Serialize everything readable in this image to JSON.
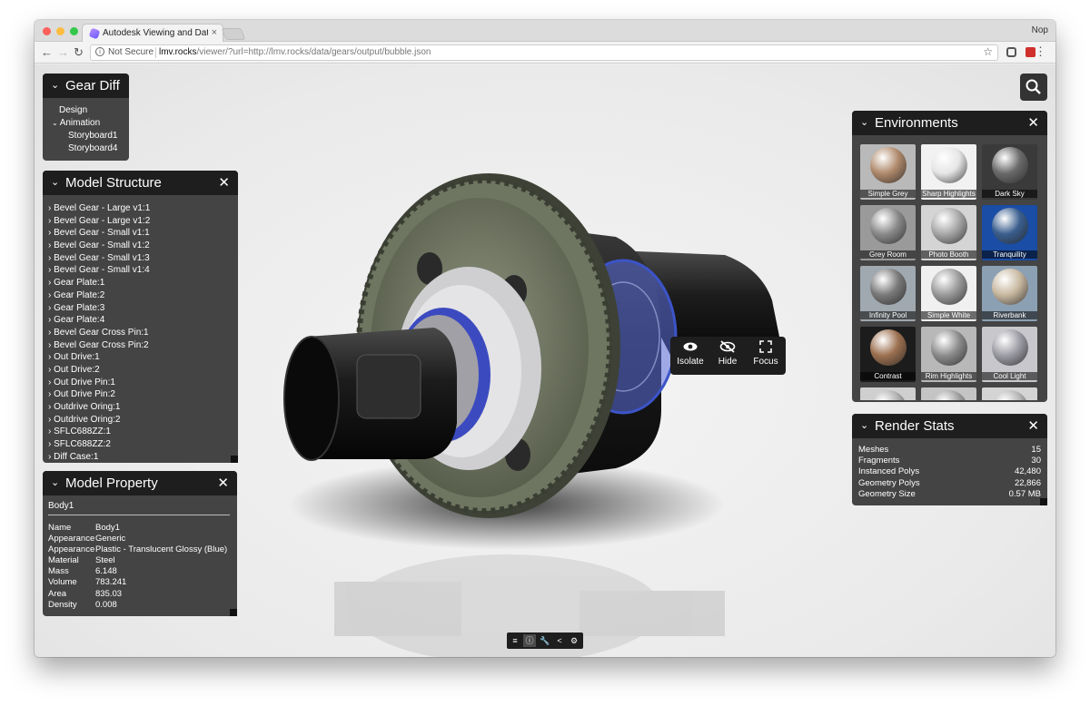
{
  "browser": {
    "tab_title": "Autodesk Viewing and Data API",
    "tab_close": "×",
    "profile": "Nop",
    "security_label": "Not Secure",
    "url_host": "lmv.rocks",
    "url_path": "/viewer/?url=http://lmv.rocks/data/gears/output/bubble.json",
    "nav_back": "←",
    "nav_forward": "→",
    "nav_reload": "↻",
    "bookmark": "☆",
    "menu": "⋮"
  },
  "gear_diff": {
    "title": "Gear Diff",
    "chevron": "⌄",
    "items": [
      "Design",
      "Animation",
      "Storyboard1",
      "Storyboard4"
    ],
    "expand_glyph": "⌄"
  },
  "model_structure": {
    "title": "Model Structure",
    "close": "✕",
    "items": [
      "Bevel Gear - Large v1:1",
      "Bevel Gear - Large v1:2",
      "Bevel Gear - Small v1:1",
      "Bevel Gear - Small v1:2",
      "Bevel Gear - Small v1:3",
      "Bevel Gear - Small v1:4",
      "Gear Plate:1",
      "Gear Plate:2",
      "Gear Plate:3",
      "Gear Plate:4",
      "Bevel Gear Cross Pin:1",
      "Bevel Gear Cross Pin:2",
      "Out Drive:1",
      "Out Drive:2",
      "Out Drive Pin:1",
      "Out Drive Pin:2",
      "Outdrive Oring:1",
      "Outdrive Oring:2",
      "SFLC688ZZ:1",
      "SFLC688ZZ:2",
      "Diff Case:1"
    ]
  },
  "model_property": {
    "title": "Model Property",
    "close": "✕",
    "node_name": "Body1",
    "rows": [
      {
        "key": "Name",
        "value": "Body1"
      },
      {
        "key": "Appearance",
        "value": "Generic"
      },
      {
        "key": "Appearance",
        "value": "Plastic - Translucent Glossy (Blue)"
      },
      {
        "key": "Material",
        "value": "Steel"
      },
      {
        "key": "Mass",
        "value": "6.148"
      },
      {
        "key": "Volume",
        "value": "783.241"
      },
      {
        "key": "Area",
        "value": "835.03"
      },
      {
        "key": "Density",
        "value": "0.008"
      }
    ]
  },
  "environments": {
    "title": "Environments",
    "close": "✕",
    "items": [
      {
        "label": "Simple Grey",
        "sphere": "#b08a6c",
        "bg": "#b9b9b9"
      },
      {
        "label": "Sharp Highlights",
        "sphere": "#e6e6e6",
        "bg": "#f2f2f2"
      },
      {
        "label": "Dark Sky",
        "sphere": "#6a6a6a",
        "bg": "#3a3a3a"
      },
      {
        "label": "Grey Room",
        "sphere": "#8a8a8a",
        "bg": "#9a9a9a"
      },
      {
        "label": "Photo Booth",
        "sphere": "#a8a8a8",
        "bg": "#d4d4d4"
      },
      {
        "label": "Tranquility",
        "sphere": "#3a5e8e",
        "bg": "#1a4da6"
      },
      {
        "label": "Infinity Pool",
        "sphere": "#7a7a7a",
        "bg": "#a0a8b0"
      },
      {
        "label": "Simple White",
        "sphere": "#9a9a9a",
        "bg": "#f0f0f0"
      },
      {
        "label": "Riverbank",
        "sphere": "#c8b8a0",
        "bg": "#8ca0b4"
      },
      {
        "label": "Contrast",
        "sphere": "#9c7050",
        "bg": "#1c1c1c"
      },
      {
        "label": "Rim Highlights",
        "sphere": "#8c8c8c",
        "bg": "#b8b8b8"
      },
      {
        "label": "Cool Light",
        "sphere": "#9c9ca4",
        "bg": "#c8c8cc"
      },
      {
        "label": "",
        "sphere": "#b0b0b0",
        "bg": "#cfcfcf"
      },
      {
        "label": "",
        "sphere": "#a0a0a0",
        "bg": "#c4c4c4"
      },
      {
        "label": "",
        "sphere": "#b4b4b4",
        "bg": "#d4d4d4"
      }
    ]
  },
  "render_stats": {
    "title": "Render Stats",
    "close": "✕",
    "rows": [
      {
        "key": "Meshes",
        "value": "15"
      },
      {
        "key": "Fragments",
        "value": "30"
      },
      {
        "key": "Instanced Polys",
        "value": "42,480"
      },
      {
        "key": "Geometry Polys",
        "value": "22,866"
      },
      {
        "key": "Geometry Size",
        "value": "0.57 MB"
      }
    ]
  },
  "context_menu": {
    "isolate": "Isolate",
    "hide": "Hide",
    "focus": "Focus"
  },
  "colors": {
    "panel_bg": "#444444",
    "panel_header": "#1e1e1e",
    "gear_green": "#6e7560",
    "part_blue": "#4a5ec8"
  }
}
